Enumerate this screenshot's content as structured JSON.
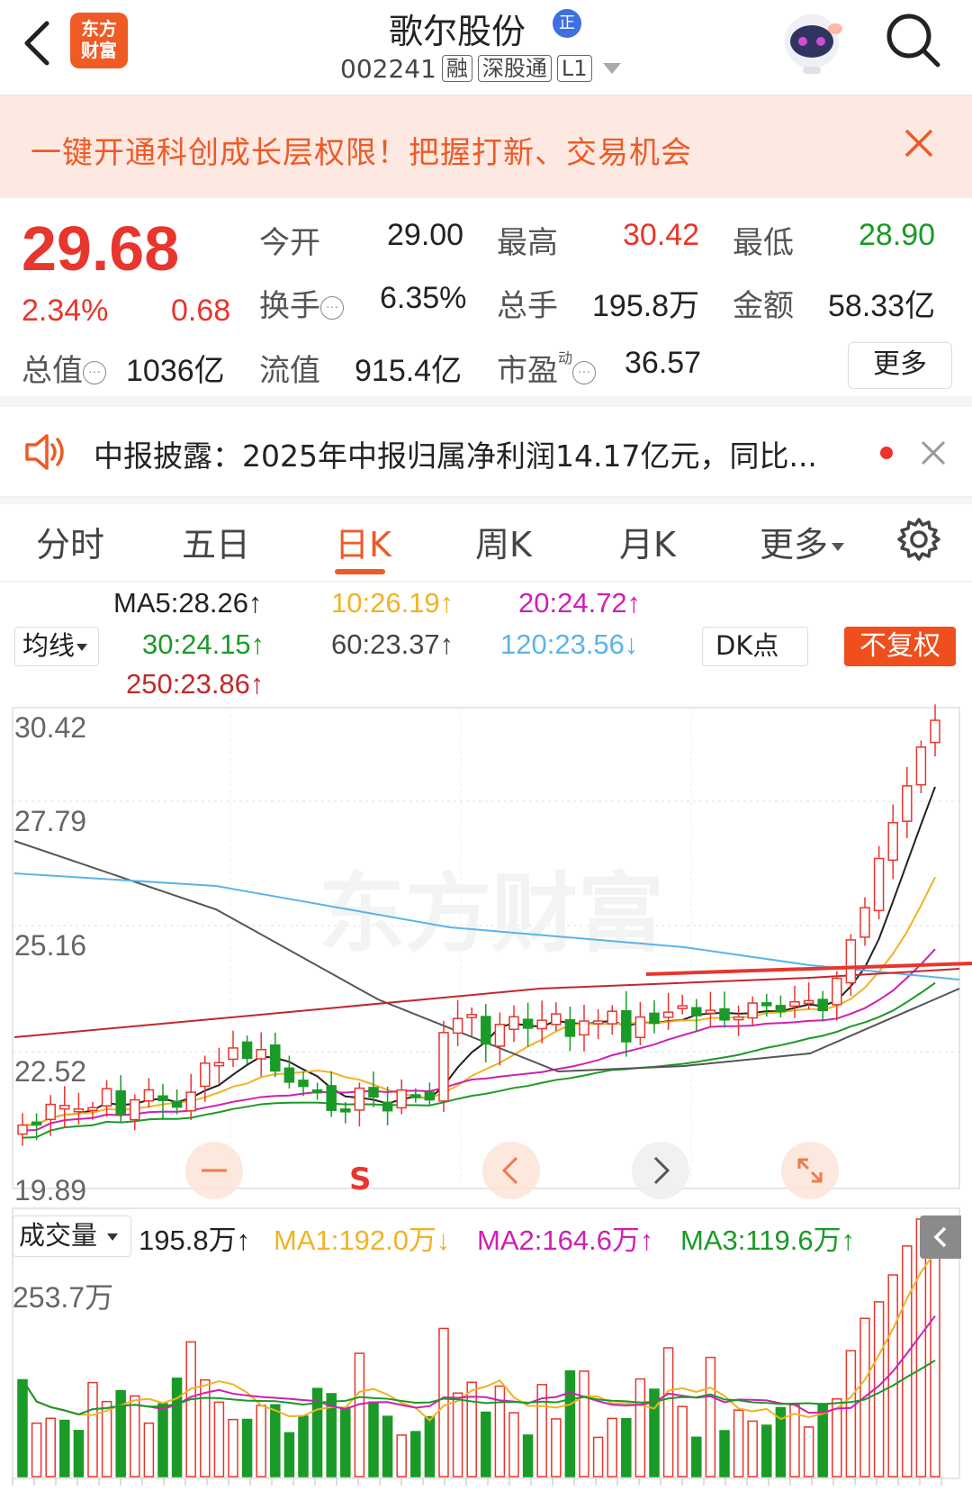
{
  "header": {
    "logo_line1": "东方",
    "logo_line2": "财富",
    "stock_name": "歌尔股份",
    "badge": "正",
    "stock_code": "002241",
    "tags": [
      "融",
      "深股通",
      "L1"
    ]
  },
  "banner": {
    "text": "一键开通科创成长层权限！把握打新、交易机会"
  },
  "quote": {
    "price": "29.68",
    "change_pct": "2.34%",
    "change": "0.68",
    "open_label": "今开",
    "open": "29.00",
    "high_label": "最高",
    "high": "30.42",
    "low_label": "最低",
    "low": "28.90",
    "turnover_label": "换手",
    "turnover": "6.35%",
    "volume_label": "总手",
    "volume": "195.8万",
    "amount_label": "金额",
    "amount": "58.33亿",
    "mktcap_label": "总值",
    "mktcap": "1036亿",
    "float_label": "流值",
    "float": "915.4亿",
    "pe_label": "市盈",
    "pe_sup": "动",
    "pe": "36.57",
    "more_label": "更多"
  },
  "news": {
    "text": "中报披露：2025年中报归属净利润14.17亿元，同比..."
  },
  "tabs": {
    "items": [
      "分时",
      "五日",
      "日K",
      "周K",
      "月K",
      "更多"
    ],
    "active": "日K"
  },
  "ma_legend": {
    "dropdown": "均线",
    "ma5": "MA5:28.26↑",
    "ma10": "10:26.19↑",
    "ma20": "20:24.72↑",
    "ma30": "30:24.15↑",
    "ma60": "60:23.37↑",
    "ma120": "120:23.56↓",
    "ma250": "250:23.86↑",
    "dk": "DK点",
    "adjust": "不复权"
  },
  "colors": {
    "up": "#e8352d",
    "down": "#1a9a26",
    "accent": "#ee5a27",
    "ma5": "#222222",
    "ma10": "#f0b323",
    "ma20": "#d01fb4",
    "ma30": "#1a9a26",
    "ma60": "#555555",
    "ma120": "#5ab4ea",
    "ma250": "#c0282c"
  },
  "price_axis": [
    "30.42",
    "27.79",
    "25.16",
    "22.52",
    "19.89"
  ],
  "watermark": "东方财富",
  "signal": "S",
  "volume": {
    "dropdown": "成交量",
    "current": "195.8万↑",
    "ma1": "MA1:192.0万↓",
    "ma2": "MA2:164.6万↑",
    "ma3": "MA3:119.6万↑",
    "axis_max": "253.7万"
  },
  "controls": [
    "minus-icon",
    "chevron-left-icon",
    "chevron-right-icon",
    "expand-icon"
  ]
}
